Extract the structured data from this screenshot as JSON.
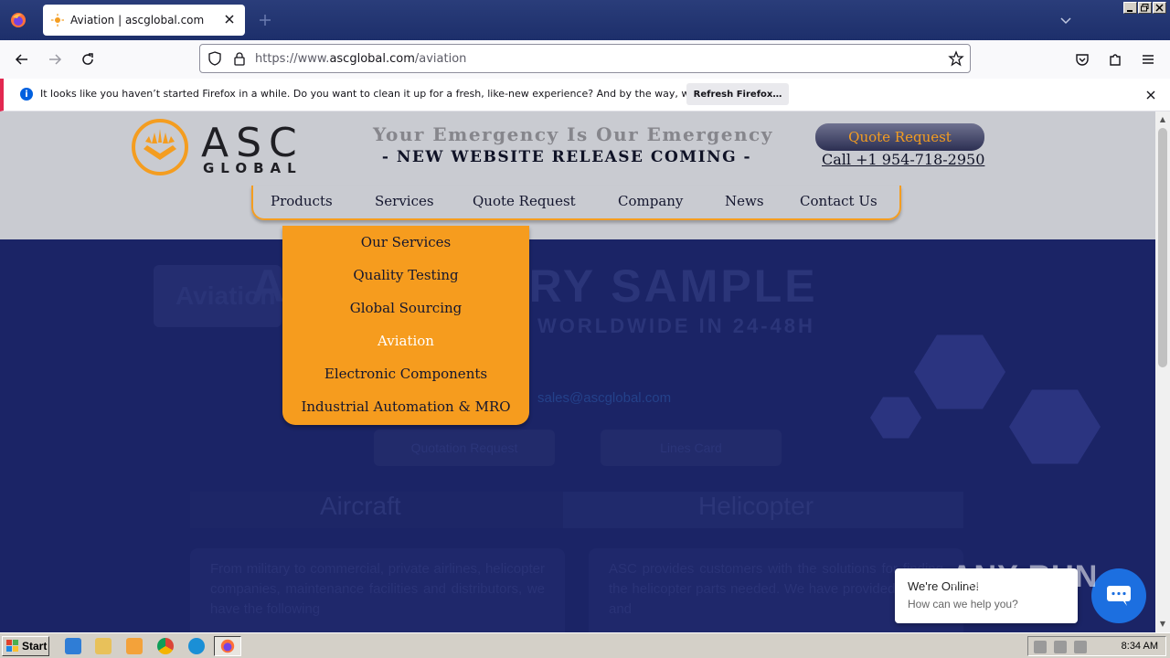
{
  "browser": {
    "tab_title": "Aviation | ascglobal.com",
    "url_prefix": "https://www.",
    "url_host": "ascglobal.com",
    "url_path": "/aviation"
  },
  "notification": {
    "message": "It looks like you haven’t started Firefox in a while. Do you want to clean it up for a fresh, like-new experience? And by the way, welcome back!",
    "button": "Refresh Firefox…"
  },
  "header": {
    "logo_word": "ASC",
    "logo_sub": "GLOBAL",
    "tagline_top": "Your Emergency Is Our Emergency",
    "tagline_bottom": "- NEW WEBSITE RELEASE COMING -",
    "quote_button": "Quote Request",
    "phone": "Call +1 954-718-2950",
    "accent_color": "#f49d20"
  },
  "nav": {
    "items": [
      "Products",
      "Services",
      "Quote Request",
      "Company",
      "News",
      "Contact Us"
    ]
  },
  "dropdown": {
    "items": [
      "Our Services",
      "Quality Testing",
      "Global Sourcing",
      "Aviation",
      "Electronic Components",
      "Industrial Automation & MRO"
    ],
    "active": "Aviation"
  },
  "hero": {
    "chip": "Aviation",
    "heading_visible": "A",
    "heading_tail": "TORY SAMPLE",
    "subheading": "WORLDWIDE IN 24-48H",
    "email": "sales@ascglobal.com",
    "cta1": "Quotation Request",
    "cta2": "Lines Card",
    "tab1": "Aircraft",
    "tab2": "Helicopter",
    "card1": "From military to commercial, private airlines, helicopter companies, maintenance facilities and distributors, we have the following",
    "card2": "ASC provides customers with the solutions for finding the helicopter parts needed. We have provided a quick and"
  },
  "chat": {
    "status": "We're Online!",
    "prompt": "How can we help you?"
  },
  "watermark": "ANY RUN",
  "taskbar": {
    "start": "Start",
    "clock": "8:34 AM"
  }
}
